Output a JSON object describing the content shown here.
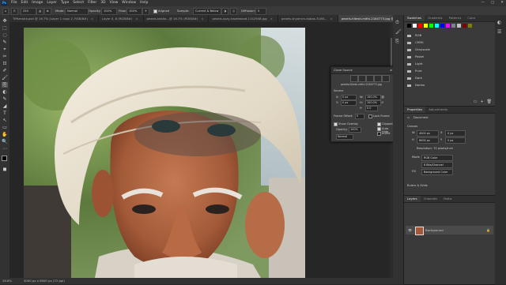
{
  "app": {
    "logo": "Ps",
    "menu": [
      "File",
      "Edit",
      "Image",
      "Layer",
      "Type",
      "Select",
      "Filter",
      "3D",
      "View",
      "Window",
      "Help"
    ],
    "window_controls": [
      "—",
      "▢",
      "✕"
    ]
  },
  "options_bar": {
    "size_value": "250",
    "mode_label": "Mode:",
    "mode_value": "Normal",
    "opacity_label": "Opacity:",
    "opacity_value": "100%",
    "flow_label": "Flow:",
    "flow_value": "100%",
    "aligned_label": "Aligned",
    "sample_label": "Sample:",
    "sample_value": "Current & Below",
    "diffusion_label": "Diffusion:",
    "diffusion_value": "5"
  },
  "tabs": [
    {
      "label": "Tiffsmaira.psd @ 16.7% (Layer 1 copy 2, RGB/8#)",
      "active": false
    },
    {
      "label": "Layer 0, 8 (RGB/8#)",
      "active": false
    },
    {
      "label": "pexels-taisiia...@ 16.7% (RGB/8#)",
      "active": false
    },
    {
      "label": "pexels-suzy-hazelwood-1142948.jpg",
      "active": false
    },
    {
      "label": "pexels-shyamra-dubas-3186...",
      "active": false
    },
    {
      "label": "pexels-hitesh-mithi-2184773.jpg @ 26.8% (RGB/8#)",
      "active": true
    }
  ],
  "tools": [
    "✥",
    "⬚",
    "◌",
    "✎",
    "⌖",
    "✂",
    "⊡",
    "✐",
    "🖌",
    "⎘",
    "◐",
    "✎",
    "◢",
    "T",
    "↖",
    "▭",
    "✋",
    "🔍",
    "⋯",
    "◼"
  ],
  "status": {
    "zoom": "26.8%",
    "doc_info": "4000 px x 6000 px (72 ppi)"
  },
  "clone_source": {
    "title": "Clone Source",
    "filename": "pexels-hitesh-mithi-2184773.jpg",
    "source_label": "Source",
    "offset_x_label": "X:",
    "offset_x": "0 px",
    "offset_y_label": "Y:",
    "offset_y": "0 px",
    "w_label": "W:",
    "w_value": "100.0%",
    "h_label": "H:",
    "h_value": "100.0%",
    "angle_value": "0.0",
    "frame_offset_label": "Frame Offset:",
    "frame_offset_value": "0",
    "lock_frame_label": "Lock Frame",
    "show_overlay_label": "Show Overlay",
    "opacity_label": "Opacity:",
    "opacity_value": "100%",
    "clipped_label": "Clipped",
    "autohide_label": "Auto Hide",
    "invert_label": "Invert",
    "mode_value": "Normal"
  },
  "swatches_panel": {
    "tabs": [
      "Swatches",
      "Gradients",
      "Patterns",
      "Color"
    ],
    "swatch_colors": [
      "#000000",
      "#ffffff",
      "#ff0000",
      "#ffff00",
      "#00ff00",
      "#00ffff",
      "#0000ff",
      "#ff00ff",
      "#808080",
      "#c0c0c0",
      "#800000",
      "#808000"
    ],
    "folders": [
      "RGB",
      "CMYK",
      "Grayscale",
      "Pastel",
      "Light",
      "Pure",
      "Dark",
      "Darker"
    ]
  },
  "properties_panel": {
    "tabs": [
      "Properties",
      "Adjustments"
    ],
    "doc_label": "Document",
    "canvas_heading": "Canvas",
    "w_label": "W",
    "w_value": "4000 px",
    "h_label": "H",
    "h_value": "6000 px",
    "x_label": "X",
    "x_value": "0 px",
    "y_label": "Y",
    "y_value": "0 px",
    "resolution": "Resolution: 72 pixels/inch",
    "mode_label": "Mode",
    "mode_value": "RGB Color",
    "depth_value": "8 Bits/Channel",
    "fill_label": "Fill",
    "fill_value": "Background Color",
    "rulers_heading": "Rulers & Grids"
  },
  "layers_panel": {
    "tabs": [
      "Layers",
      "Channels",
      "Paths"
    ],
    "layer_name": "Background"
  },
  "colors": {
    "accent": "#31a8ff",
    "app_bg": "#282828",
    "panel_bg": "#3a3a3a"
  }
}
